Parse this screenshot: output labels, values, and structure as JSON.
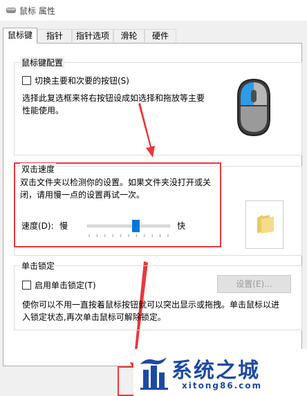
{
  "window": {
    "title": "鼠标 属性"
  },
  "tabs": [
    {
      "label": "鼠标键",
      "active": true
    },
    {
      "label": "指针",
      "active": false
    },
    {
      "label": "指针选项",
      "active": false
    },
    {
      "label": "滑轮",
      "active": false
    },
    {
      "label": "硬件",
      "active": false
    }
  ],
  "button_config": {
    "title": "鼠标键配置",
    "checkbox_label": "切换主要和次要的按钮(S)",
    "checkbox_checked": false,
    "description_line1": "选择此复选框来将右按钮设成如选择和拖放等主要",
    "description_line2": "性能使用。",
    "icon": "mouse-icon"
  },
  "double_click": {
    "title": "双击速度",
    "description_line1": "双击文件夹以检测你的设置。如果文件夹没打开或关",
    "description_line2": "闭，请用慢一点的设置再试一次。",
    "speed_label": "速度(D):",
    "slow_label": "慢",
    "fast_label": "快",
    "speed_value": 0.6,
    "test_icon": "folder-icon"
  },
  "click_lock": {
    "title": "单击锁定",
    "checkbox_label": "启用单击锁定(T)",
    "checkbox_checked": false,
    "settings_button": "设置(E)...",
    "description_line1": "使你可以不用一直按着鼠标按钮就可以突出显示或拖拽。单击鼠标以进",
    "description_line2": "入锁定状态,再次单击鼠标可解除锁定。"
  },
  "watermark": {
    "brand": "系统之城",
    "url": "xitong86.com"
  },
  "colors": {
    "highlight": "#e8383d",
    "accent": "#0078d7",
    "brand": "#1c4aa3"
  }
}
